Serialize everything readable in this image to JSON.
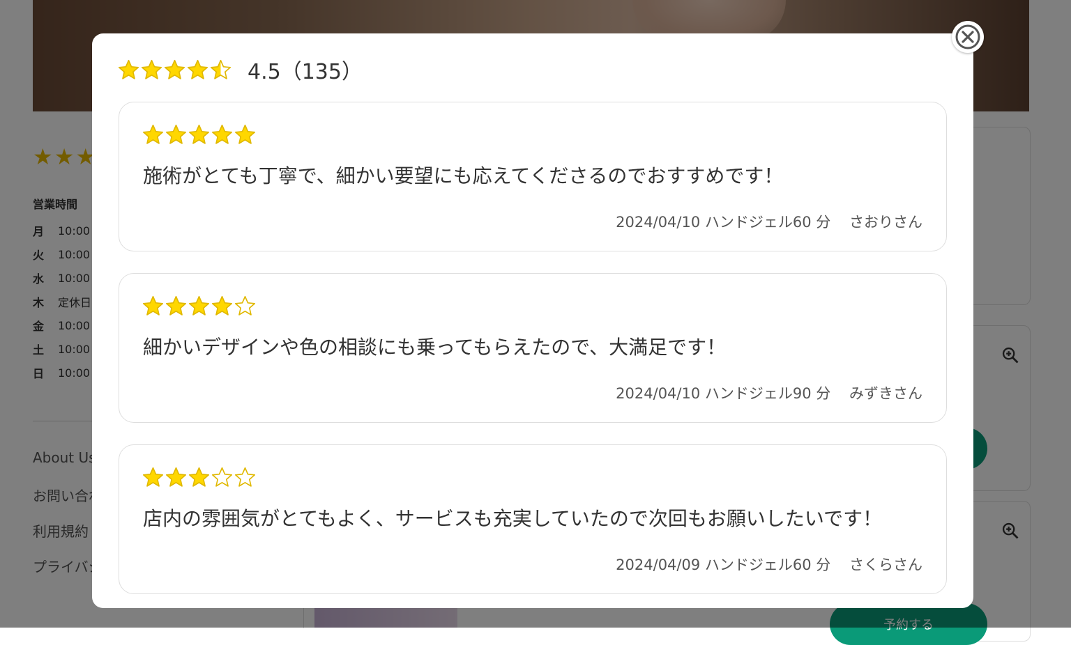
{
  "background": {
    "hours_title": "営業時間",
    "hours": [
      {
        "day": "月",
        "time": "10:00"
      },
      {
        "day": "火",
        "time": "10:00"
      },
      {
        "day": "水",
        "time": "10:00"
      },
      {
        "day": "木",
        "time": "定休日"
      },
      {
        "day": "金",
        "time": "10:00"
      },
      {
        "day": "土",
        "time": "10:00"
      },
      {
        "day": "日",
        "time": "10:00"
      }
    ],
    "footer_links": [
      "About Us",
      "お問い合わせ",
      "利用規約",
      "プライバシー"
    ],
    "reserve_label": "予約する"
  },
  "modal": {
    "rating": 4.5,
    "rating_text": "4.5（135）",
    "star_color": "#FFD700",
    "reviews": [
      {
        "stars": 5,
        "text": "施術がとても丁寧で、細かい要望にも応えてくださるのでおすすめです！",
        "date": "2024/04/10",
        "menu": "ハンドジェル60 分",
        "author": "さおりさん"
      },
      {
        "stars": 4,
        "text": "細かいデザインや色の相談にも乗ってもらえたので、大満足です！",
        "date": "2024/04/10",
        "menu": "ハンドジェル90 分",
        "author": "みずきさん"
      },
      {
        "stars": 3,
        "text": "店内の雰囲気がとてもよく、サービスも充実していたので次回もお願いしたいです！",
        "date": "2024/04/09",
        "menu": "ハンドジェル60 分",
        "author": "さくらさん"
      }
    ]
  }
}
